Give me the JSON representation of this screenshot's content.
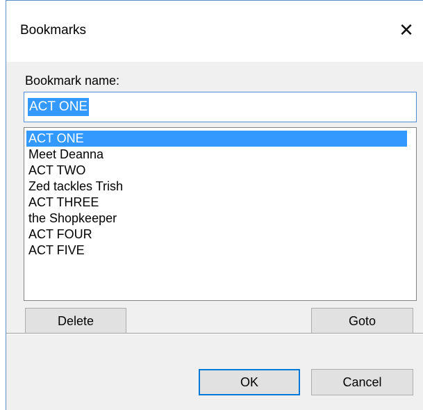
{
  "dialog": {
    "title": "Bookmarks",
    "close_glyph": "✕"
  },
  "form": {
    "name_label": "Bookmark name:",
    "name_value": "ACT ONE"
  },
  "bookmarks": {
    "selected_index": 0,
    "items": [
      "ACT ONE",
      "Meet Deanna",
      "ACT TWO",
      "Zed tackles Trish",
      "ACT THREE",
      "the Shopkeeper",
      "ACT FOUR",
      "ACT FIVE"
    ]
  },
  "buttons": {
    "delete": "Delete",
    "goto": "Goto",
    "ok": "OK",
    "cancel": "Cancel"
  },
  "colors": {
    "selection": "#3399ff",
    "focus_border": "#0078d7",
    "button_face": "#e1e1e1",
    "dialog_bg": "#f0f0f0"
  }
}
